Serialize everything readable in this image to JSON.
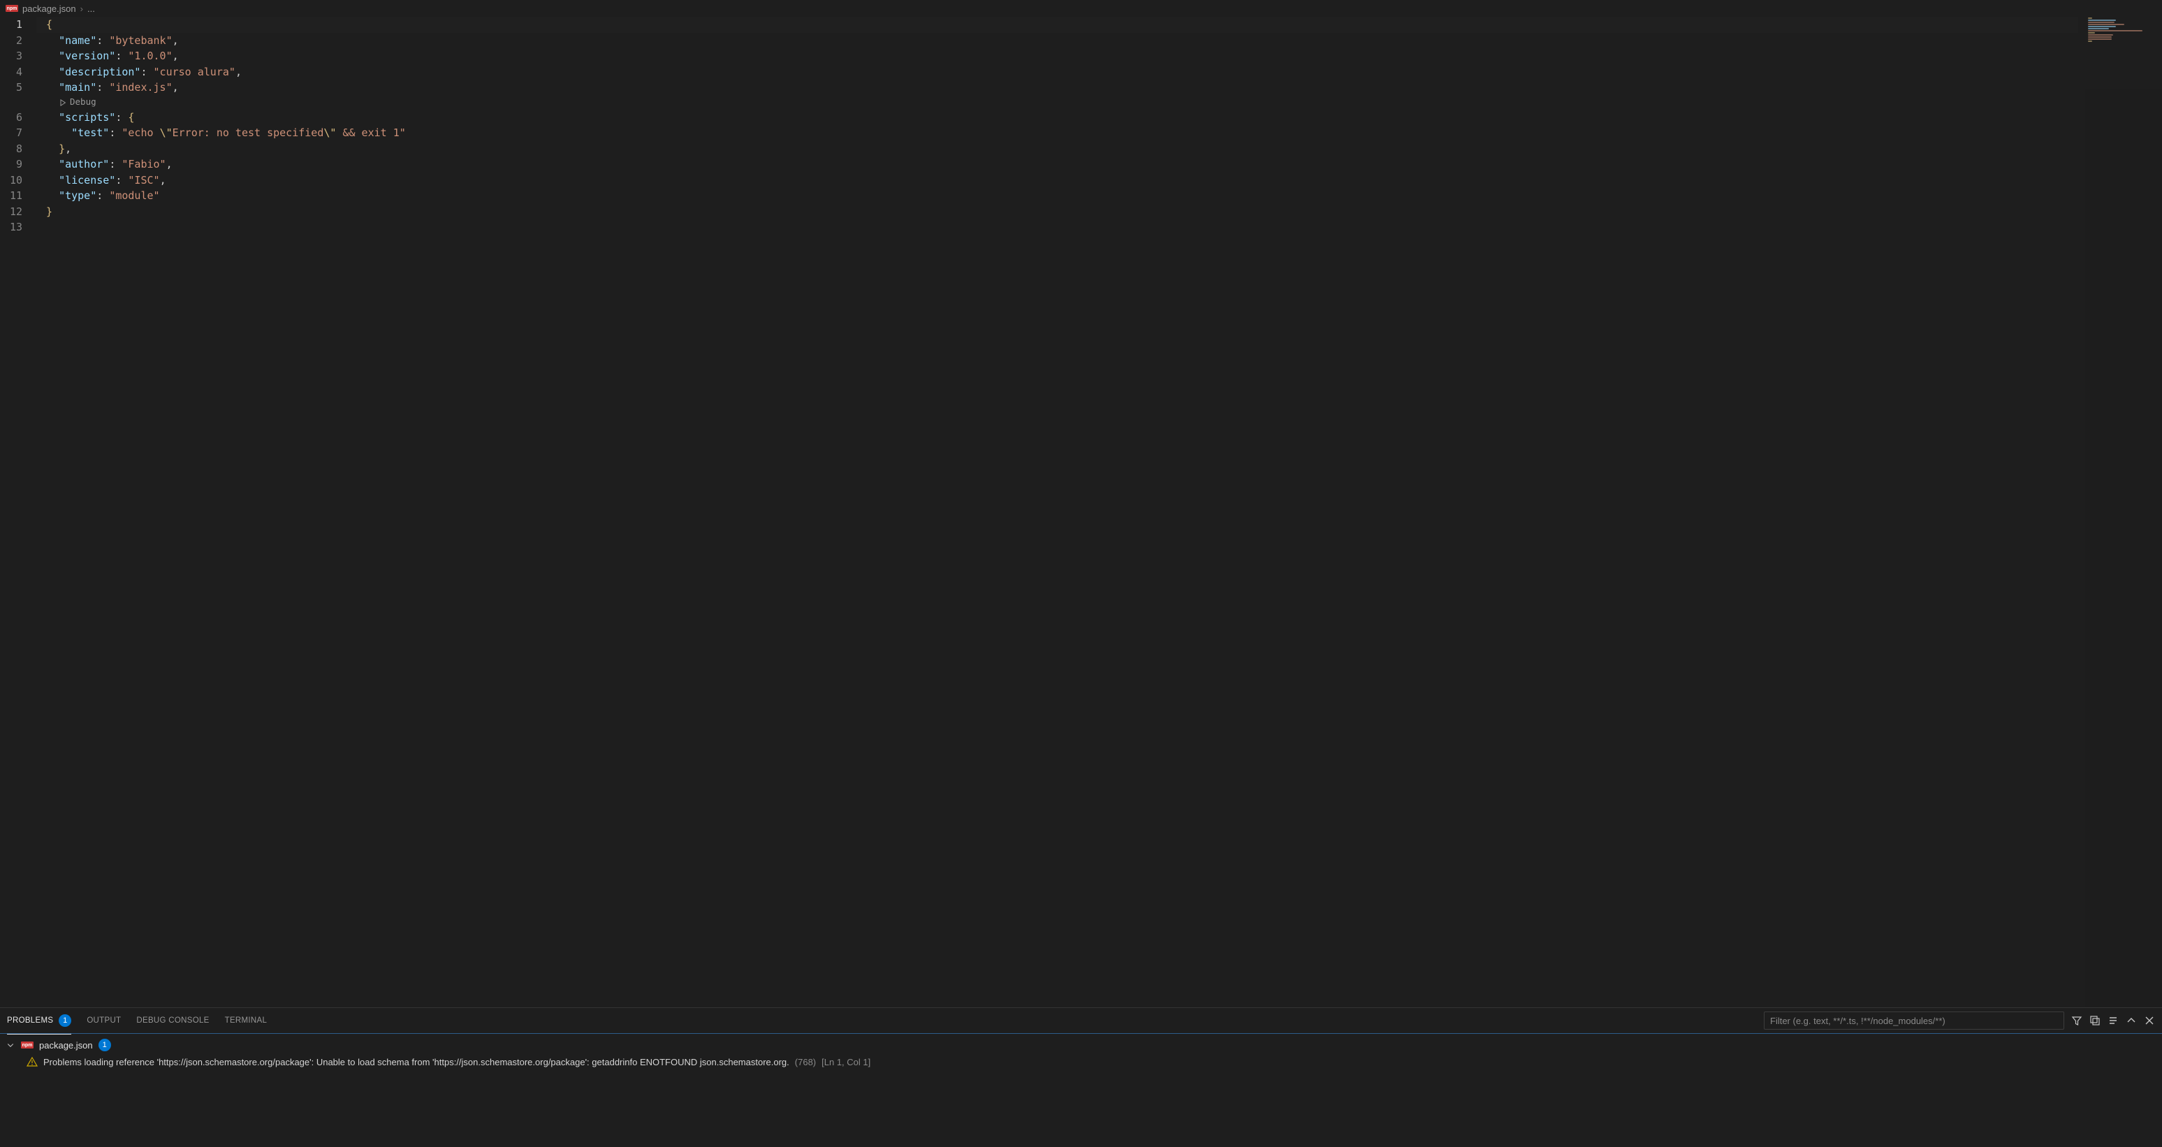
{
  "breadcrumb": {
    "filename": "package.json",
    "ellipsis": "..."
  },
  "editor": {
    "lineNumbers": [
      "1",
      "2",
      "3",
      "4",
      "5",
      "6",
      "7",
      "8",
      "9",
      "10",
      "11",
      "12",
      "13"
    ],
    "currentLine": 1,
    "codelens": {
      "label": "Debug"
    }
  },
  "json_content": {
    "name": "bytebank",
    "version": "1.0.0",
    "description": "curso alura",
    "main": "index.js",
    "scripts": {
      "test": "echo \\\"Error: no test specified\\\" && exit 1"
    },
    "author": "Fabio",
    "license": "ISC",
    "type": "module"
  },
  "code_tokens": {
    "l1": [
      {
        "c": "br",
        "t": "{"
      }
    ],
    "l2": [
      {
        "c": "k",
        "t": "\"name\""
      },
      {
        "c": "p",
        "t": ": "
      },
      {
        "c": "s",
        "t": "\"bytebank\""
      },
      {
        "c": "p",
        "t": ","
      }
    ],
    "l3": [
      {
        "c": "k",
        "t": "\"version\""
      },
      {
        "c": "p",
        "t": ": "
      },
      {
        "c": "s",
        "t": "\"1.0.0\""
      },
      {
        "c": "p",
        "t": ","
      }
    ],
    "l4": [
      {
        "c": "k",
        "t": "\"description\""
      },
      {
        "c": "p",
        "t": ": "
      },
      {
        "c": "s",
        "t": "\"curso alura\""
      },
      {
        "c": "p",
        "t": ","
      }
    ],
    "l5": [
      {
        "c": "k",
        "t": "\"main\""
      },
      {
        "c": "p",
        "t": ": "
      },
      {
        "c": "s",
        "t": "\"index.js\""
      },
      {
        "c": "p",
        "t": ","
      }
    ],
    "l6": [
      {
        "c": "k",
        "t": "\"scripts\""
      },
      {
        "c": "p",
        "t": ": "
      },
      {
        "c": "br",
        "t": "{"
      }
    ],
    "l7": [
      {
        "c": "k",
        "t": "\"test\""
      },
      {
        "c": "p",
        "t": ": "
      },
      {
        "c": "s",
        "t": "\"echo "
      },
      {
        "c": "esc",
        "t": "\\\""
      },
      {
        "c": "s",
        "t": "Error: no test specified"
      },
      {
        "c": "esc",
        "t": "\\\""
      },
      {
        "c": "s",
        "t": " && exit 1\""
      }
    ],
    "l8": [
      {
        "c": "br",
        "t": "}"
      },
      {
        "c": "p",
        "t": ","
      }
    ],
    "l9": [
      {
        "c": "k",
        "t": "\"author\""
      },
      {
        "c": "p",
        "t": ": "
      },
      {
        "c": "s",
        "t": "\"Fabio\""
      },
      {
        "c": "p",
        "t": ","
      }
    ],
    "l10": [
      {
        "c": "k",
        "t": "\"license\""
      },
      {
        "c": "p",
        "t": ": "
      },
      {
        "c": "s",
        "t": "\"ISC\""
      },
      {
        "c": "p",
        "t": ","
      }
    ],
    "l11": [
      {
        "c": "k",
        "t": "\"type\""
      },
      {
        "c": "p",
        "t": ": "
      },
      {
        "c": "s",
        "t": "\"module\""
      }
    ],
    "l12": [
      {
        "c": "br",
        "t": "}"
      }
    ],
    "l13": []
  },
  "panel": {
    "tabs": {
      "problems": "PROBLEMS",
      "problems_badge": "1",
      "output": "OUTPUT",
      "debug_console": "DEBUG CONSOLE",
      "terminal": "TERMINAL"
    },
    "filter_placeholder": "Filter (e.g. text, **/*.ts, !**/node_modules/**)",
    "file": {
      "name": "package.json",
      "badge": "1"
    },
    "item": {
      "message": "Problems loading reference 'https://json.schemastore.org/package': Unable to load schema from 'https://json.schemastore.org/package': getaddrinfo ENOTFOUND json.schemastore.org.",
      "code": "(768)",
      "location": "[Ln 1, Col 1]"
    }
  }
}
